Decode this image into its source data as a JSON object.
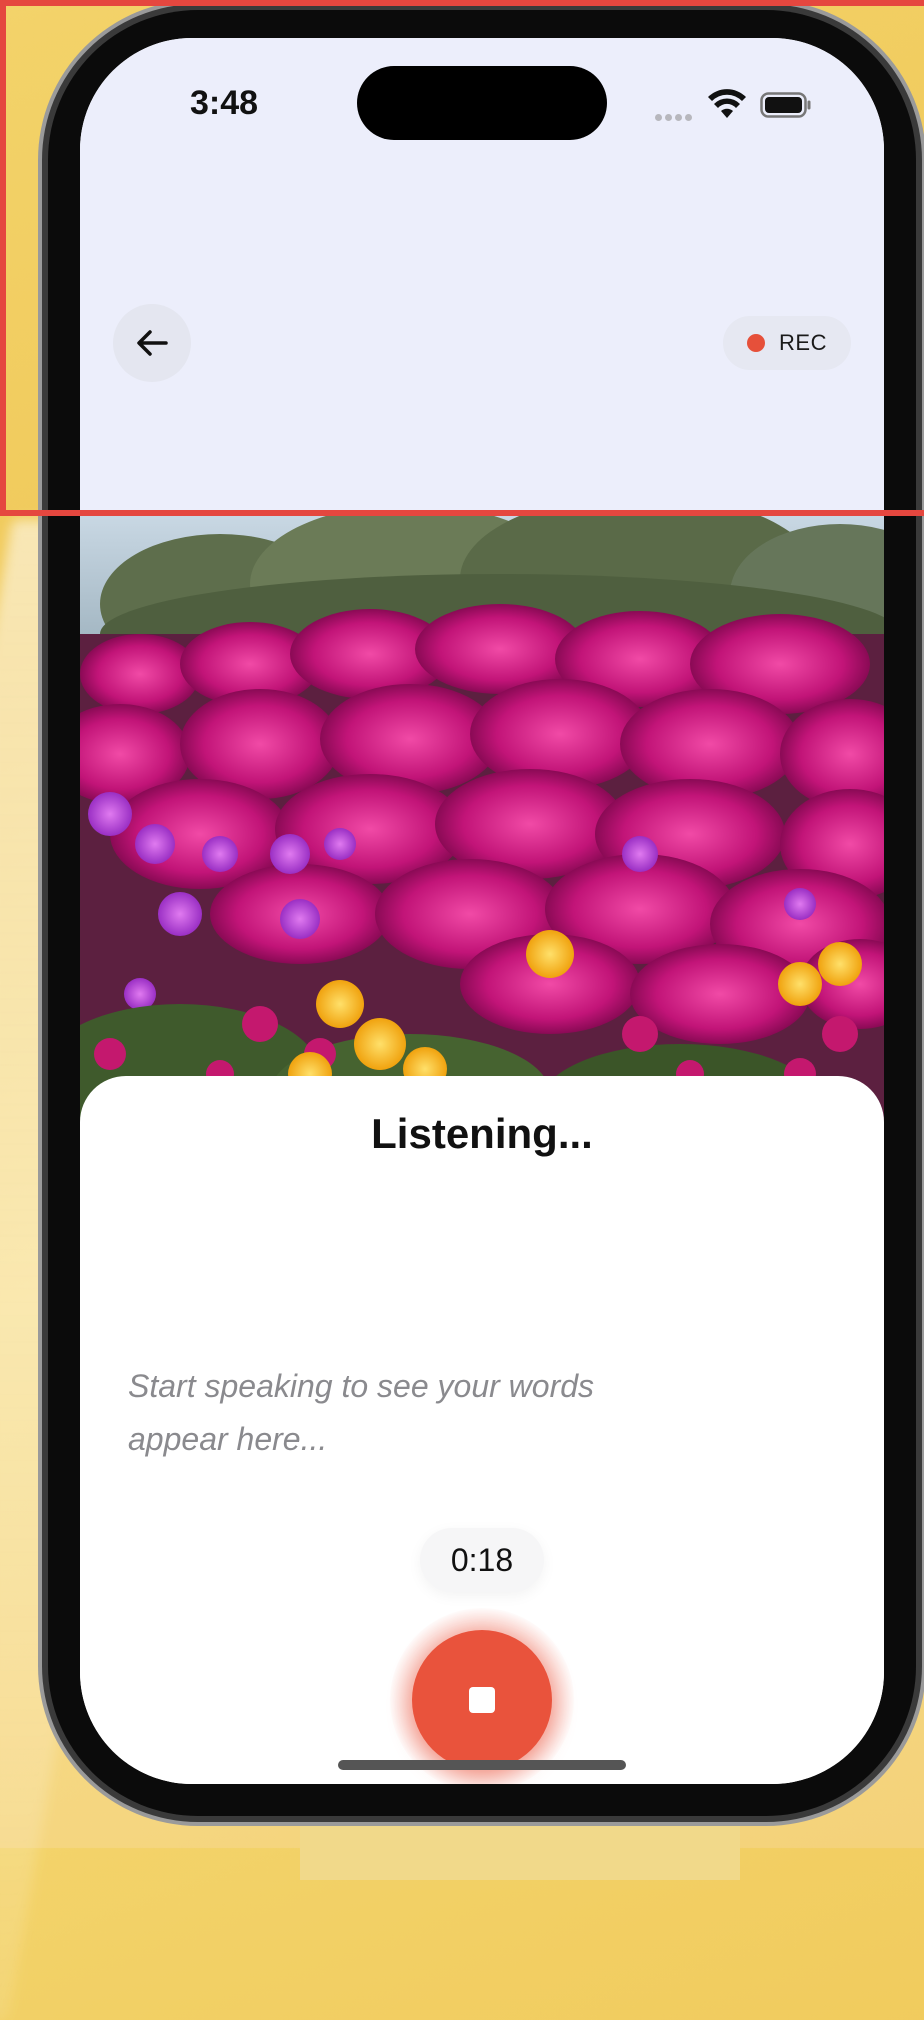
{
  "status_bar": {
    "time": "3:48",
    "icons": [
      "signal-dots-icon",
      "wifi-icon",
      "battery-icon"
    ]
  },
  "header": {
    "back_icon": "arrow-left-icon",
    "rec_label": "REC",
    "rec_color": "#e6503a"
  },
  "photo": {
    "subject": "flower-field-image"
  },
  "sheet": {
    "title": "Listening...",
    "placeholder": "Start speaking to see your words appear here...",
    "timer": "0:18",
    "stop_icon": "stop-icon"
  },
  "colors": {
    "accent": "#e9533c",
    "header_bg": "#eceefb",
    "highlight": "#e5473f"
  }
}
